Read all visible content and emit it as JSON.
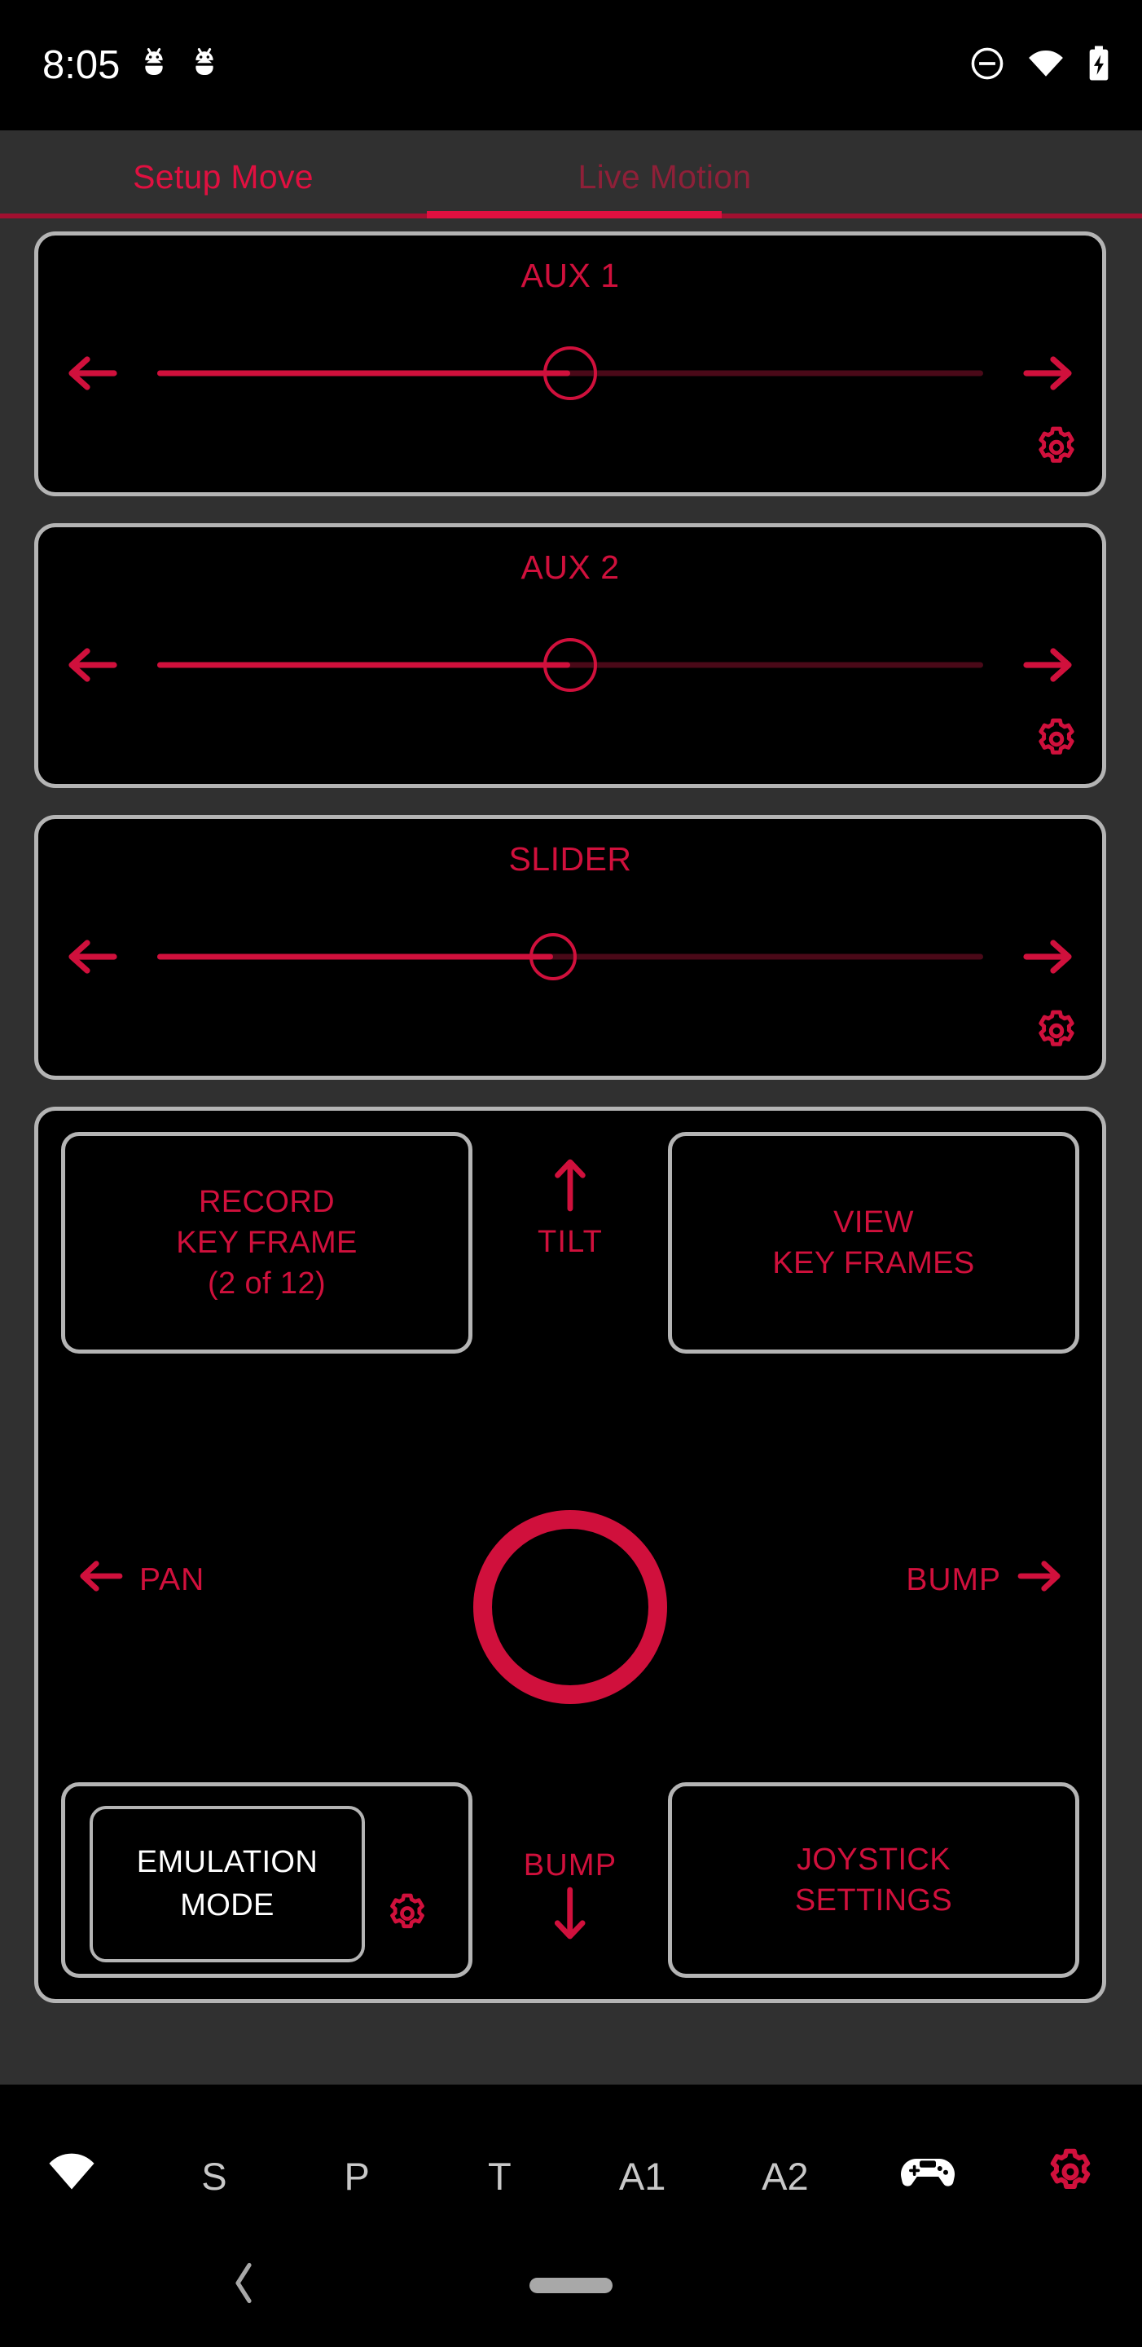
{
  "status_bar": {
    "time": "8:05",
    "left_icons": [
      "android-bug-icon",
      "android-bug-icon"
    ],
    "right_icons": [
      "do-not-disturb-icon",
      "wifi-icon",
      "battery-charging-icon"
    ]
  },
  "tabs": {
    "items": [
      {
        "label": "Setup Move",
        "active": true
      },
      {
        "label": "Live Motion",
        "active": false
      }
    ],
    "active_color": "#e01040",
    "inactive_color": "#8e2038"
  },
  "sliders": [
    {
      "title": "AUX 1",
      "value_percent": 50,
      "left_icon": "arrow-left-icon",
      "right_icon": "arrow-right-icon",
      "settings_icon": "gear-icon"
    },
    {
      "title": "AUX 2",
      "value_percent": 50,
      "left_icon": "arrow-left-icon",
      "right_icon": "arrow-right-icon",
      "settings_icon": "gear-icon"
    },
    {
      "title": "SLIDER",
      "value_percent": 48,
      "left_icon": "arrow-left-icon",
      "right_icon": "arrow-right-icon",
      "settings_icon": "gear-icon"
    }
  ],
  "panel": {
    "record_button": {
      "line1": "RECORD",
      "line2": "KEY FRAME",
      "line3": "(2 of 12)"
    },
    "view_button": {
      "line1": "VIEW",
      "line2": "KEY FRAMES"
    },
    "tilt": {
      "label": "TILT",
      "icon": "arrow-up-icon"
    },
    "bump_down": {
      "label": "BUMP",
      "icon": "arrow-down-icon"
    },
    "pan": {
      "label": "PAN",
      "icon": "arrow-left-icon"
    },
    "bump_right": {
      "label": "BUMP",
      "icon": "arrow-right-icon"
    },
    "joystick": {
      "icon": "joystick-ring-icon"
    },
    "emulation_button": {
      "line1": "EMULATION",
      "line2": "MODE",
      "settings_icon": "gear-icon"
    },
    "joystick_settings_button": {
      "line1": "JOYSTICK",
      "line2": "SETTINGS"
    }
  },
  "bottom_nav": {
    "items": [
      {
        "label": "",
        "icon": "wifi-icon"
      },
      {
        "label": "S",
        "icon": ""
      },
      {
        "label": "P",
        "icon": ""
      },
      {
        "label": "T",
        "icon": ""
      },
      {
        "label": "A1",
        "icon": ""
      },
      {
        "label": "A2",
        "icon": ""
      },
      {
        "label": "",
        "icon": "gamepad-icon"
      },
      {
        "label": "",
        "icon": "gear-icon"
      }
    ]
  },
  "android_nav": {
    "back_icon": "chevron-left-icon",
    "home_pill": "home-pill-indicator"
  },
  "colors": {
    "accent_red": "#d0103c",
    "accent_red_bright": "#e01040",
    "track_dim_red": "#4a0918",
    "border_gray": "#b4b4b4",
    "bg_dark": "#303030",
    "bg_black": "#000000",
    "nav_text": "#c8c8c8"
  }
}
